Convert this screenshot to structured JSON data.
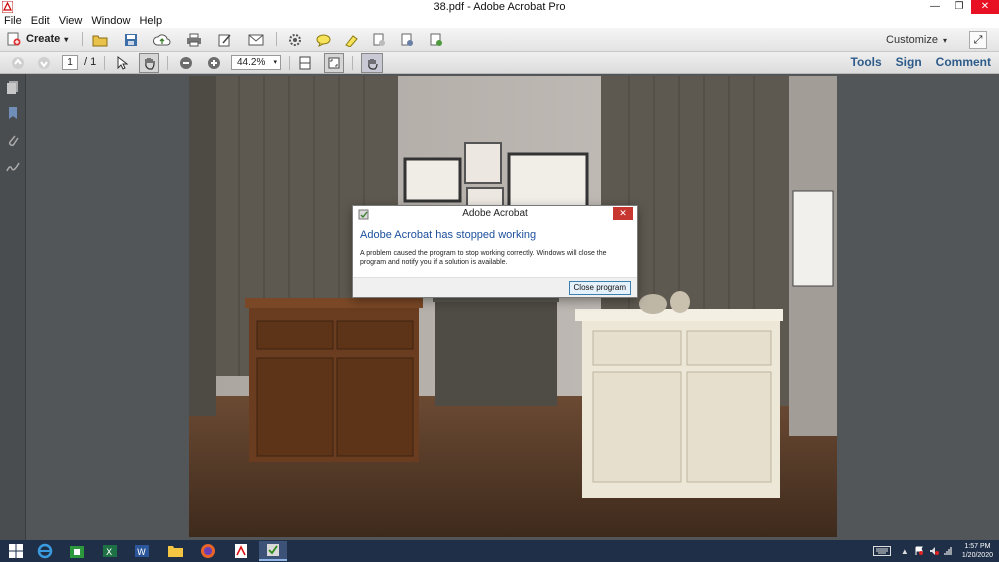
{
  "window": {
    "title": "38.pdf - Adobe Acrobat Pro",
    "controls": {
      "minimize": "—",
      "maximize": "❐",
      "close": "✕"
    }
  },
  "menu": [
    "File",
    "Edit",
    "View",
    "Window",
    "Help"
  ],
  "toolbar": {
    "create_label": "Create",
    "create_arrow": "▾",
    "customize_label": "Customize",
    "customize_arrow": "▾"
  },
  "nav": {
    "page_current": "1",
    "page_total": "/ 1",
    "zoom": "44.2%",
    "zoom_arrow": "▾"
  },
  "right_links": [
    "Tools",
    "Sign",
    "Comment"
  ],
  "dialog": {
    "title": "Adobe Acrobat",
    "heading": "Adobe Acrobat has stopped working",
    "message": "A problem caused the program to stop working correctly. Windows will close the program and notify you if a solution is available.",
    "button": "Close program",
    "close_glyph": "✕"
  },
  "taskbar": {
    "time": "1:57 PM",
    "date": "1/20/2020"
  },
  "colors": {
    "accent": "#2d5b8a",
    "dialog_heading": "#1c4f9c",
    "taskbar": "#1f2f48",
    "close_red": "#e81123"
  }
}
